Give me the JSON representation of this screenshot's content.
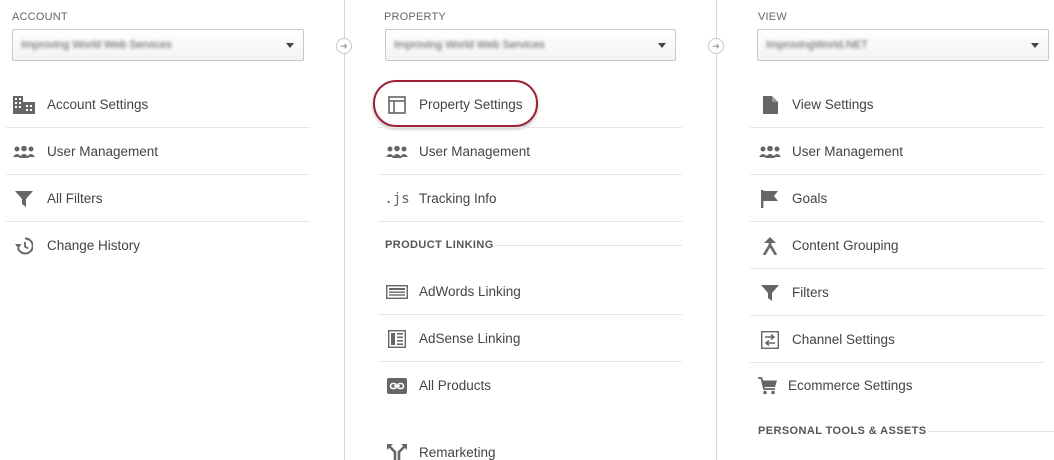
{
  "account": {
    "header": "ACCOUNT",
    "selected": "Improving World Web Services",
    "items": [
      {
        "label": "Account Settings",
        "icon": "building-icon"
      },
      {
        "label": "User Management",
        "icon": "users-icon"
      },
      {
        "label": "All Filters",
        "icon": "filter-icon"
      },
      {
        "label": "Change History",
        "icon": "history-icon"
      }
    ]
  },
  "property": {
    "header": "PROPERTY",
    "selected": "Improving World Web Services",
    "items": [
      {
        "label": "Property Settings",
        "icon": "layout-icon"
      },
      {
        "label": "User Management",
        "icon": "users-icon"
      },
      {
        "label": "Tracking Info",
        "icon": "js-icon"
      }
    ],
    "section_title": "PRODUCT LINKING",
    "linking_items": [
      {
        "label": "AdWords Linking",
        "icon": "adwords-icon"
      },
      {
        "label": "AdSense Linking",
        "icon": "adsense-icon"
      },
      {
        "label": "All Products",
        "icon": "link-icon"
      },
      {
        "label": "Remarketing",
        "icon": "remarketing-icon"
      }
    ]
  },
  "view": {
    "header": "VIEW",
    "selected": "ImprovingWorld.NET",
    "items": [
      {
        "label": "View Settings",
        "icon": "document-icon"
      },
      {
        "label": "User Management",
        "icon": "users-icon"
      },
      {
        "label": "Goals",
        "icon": "flag-icon"
      },
      {
        "label": "Content Grouping",
        "icon": "content-grouping-icon"
      },
      {
        "label": "Filters",
        "icon": "filter-icon"
      },
      {
        "label": "Channel Settings",
        "icon": "channel-icon"
      },
      {
        "label": "Ecommerce Settings",
        "icon": "cart-icon"
      }
    ],
    "section_title": "PERSONAL TOOLS & ASSETS"
  },
  "colors": {
    "highlight": "#9b2335",
    "icon": "#666666",
    "divider": "#d6d6d6"
  }
}
